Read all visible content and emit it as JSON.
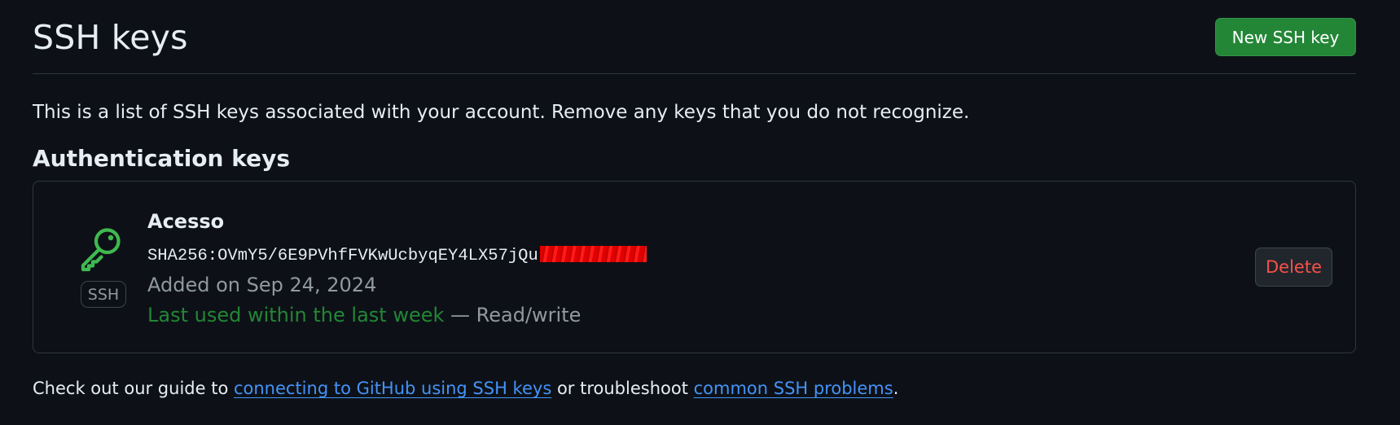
{
  "header": {
    "title": "SSH keys",
    "new_key_label": "New SSH key"
  },
  "intro": "This is a list of SSH keys associated with your account. Remove any keys that you do not recognize.",
  "section": {
    "heading": "Authentication keys"
  },
  "keys": [
    {
      "icon": "key-icon",
      "type": "SSH",
      "name": "Acesso",
      "fingerprint": "SHA256:OVmY5/6E9PVhfFVKwUcbyqEY4LX57jQu",
      "added": "Added on Sep 24, 2024",
      "last_used": "Last used within the last week",
      "access": " — Read/write",
      "delete_label": "Delete"
    }
  ],
  "footer": {
    "prefix": "Check out our guide to ",
    "link1": "connecting to GitHub using SSH keys",
    "middle": " or troubleshoot ",
    "link2": "common SSH problems",
    "suffix": "."
  },
  "colors": {
    "background": "#0d1117",
    "primary_button": "#238636",
    "danger": "#f85149",
    "link": "#4493f8",
    "success_text": "#238636",
    "key_icon": "#3fb950"
  }
}
